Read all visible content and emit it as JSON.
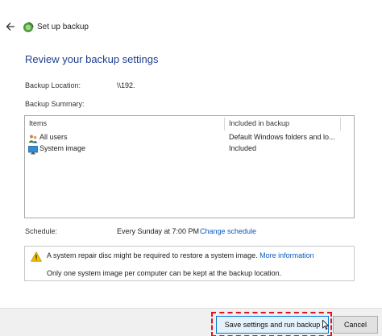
{
  "window": {
    "title": "Set up backup",
    "back_icon": "back-arrow-icon",
    "app_icon": "backup-icon"
  },
  "heading": "Review your backup settings",
  "backup_location": {
    "label": "Backup Location:",
    "value": "\\\\192."
  },
  "backup_summary": {
    "label": "Backup Summary:",
    "columns": [
      "Items",
      "Included in backup"
    ],
    "rows": [
      {
        "item": "All users",
        "included": "Default Windows folders and lo...",
        "icon": "users-icon"
      },
      {
        "item": "System image",
        "included": "Included",
        "icon": "monitor-icon"
      }
    ]
  },
  "schedule": {
    "label": "Schedule:",
    "value": "Every Sunday at 7:00 PM",
    "change_link": "Change schedule"
  },
  "notice": {
    "warning_text": "A system repair disc might be required to restore a system image.",
    "more_info_link": "More information",
    "info_text": "Only one system image per computer can be kept at the backup location."
  },
  "buttons": {
    "save_run": "Save settings and run backup",
    "cancel": "Cancel"
  },
  "colors": {
    "heading": "#1e3f8f",
    "link": "#0a58c2",
    "highlight": "#e0131b",
    "warning": "#f2c200"
  }
}
